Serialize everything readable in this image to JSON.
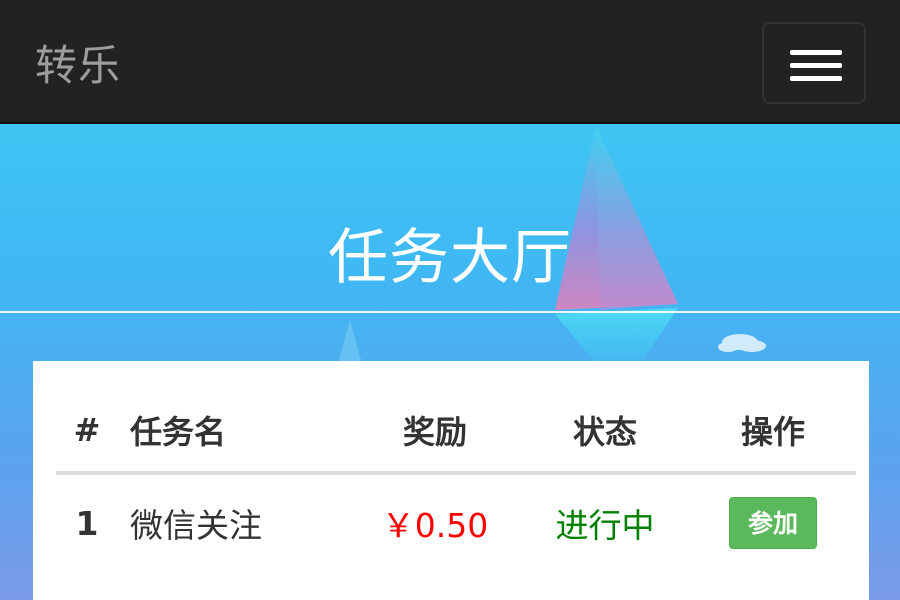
{
  "navbar": {
    "brand": "转乐",
    "menu_icon": "hamburger-menu-icon"
  },
  "hero": {
    "title": "任务大厅"
  },
  "table": {
    "headers": [
      "#",
      "任务名",
      "奖励",
      "状态",
      "操作"
    ],
    "rows": [
      {
        "num": "1",
        "name": "微信关注",
        "reward": "￥0.50",
        "status": "进行中",
        "action": "参加"
      }
    ]
  },
  "colors": {
    "navbar_bg": "#222222",
    "brand_text": "#9d9d9d",
    "reward": "#ff0000",
    "status_active": "#008000",
    "action_button": "#5cb85c"
  }
}
